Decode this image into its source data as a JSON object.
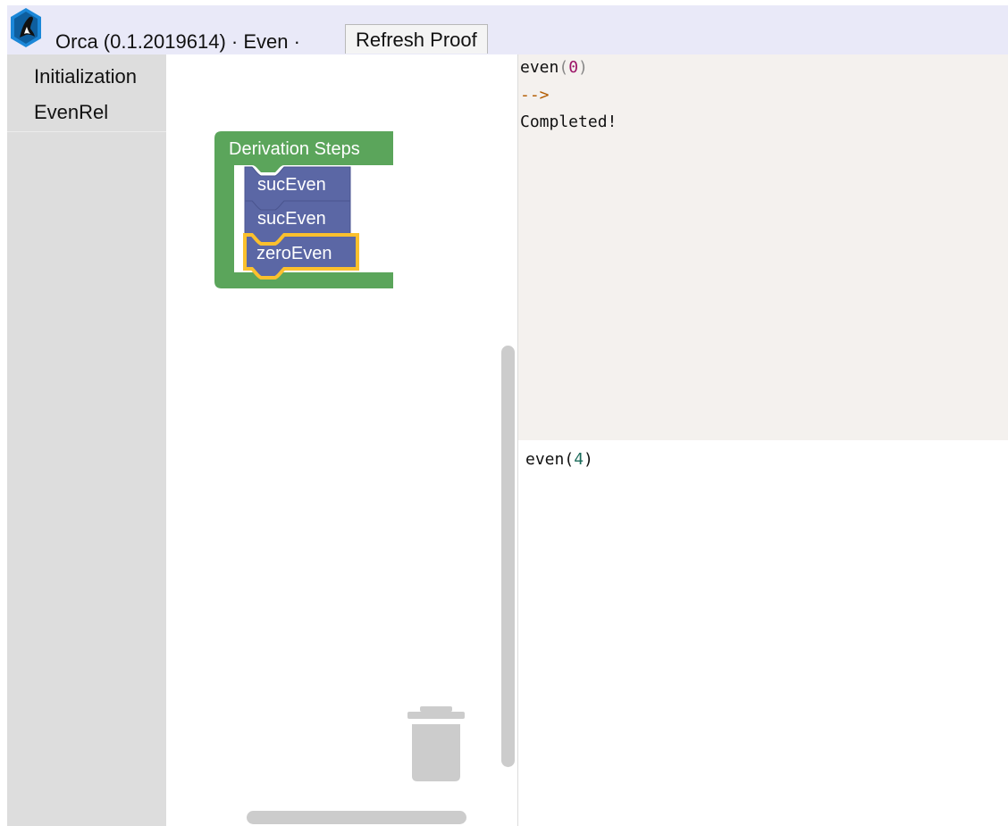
{
  "header": {
    "app_title": "Orca (0.1.2019614) · Even ·",
    "refresh_label": "Refresh Proof",
    "logo_icon": "orca-logo-icon"
  },
  "sidebar": {
    "items": [
      {
        "label": "Initialization"
      },
      {
        "label": "EvenRel"
      }
    ]
  },
  "workspace": {
    "container_block": {
      "label": "Derivation Steps",
      "color": "#5ba55b"
    },
    "steps": [
      {
        "label": "sucEven",
        "color": "#5b67a5"
      },
      {
        "label": "sucEven",
        "color": "#5b67a5"
      },
      {
        "label": "zeroEven",
        "color": "#5b67a5",
        "selected": true,
        "highlight": "#fbc02d"
      }
    ],
    "trash_icon": "trash-can-icon"
  },
  "output": {
    "fn": "even",
    "arg": "0",
    "arrow": "-->",
    "status": "Completed!"
  },
  "input": {
    "fn": "even",
    "arg": "4"
  }
}
